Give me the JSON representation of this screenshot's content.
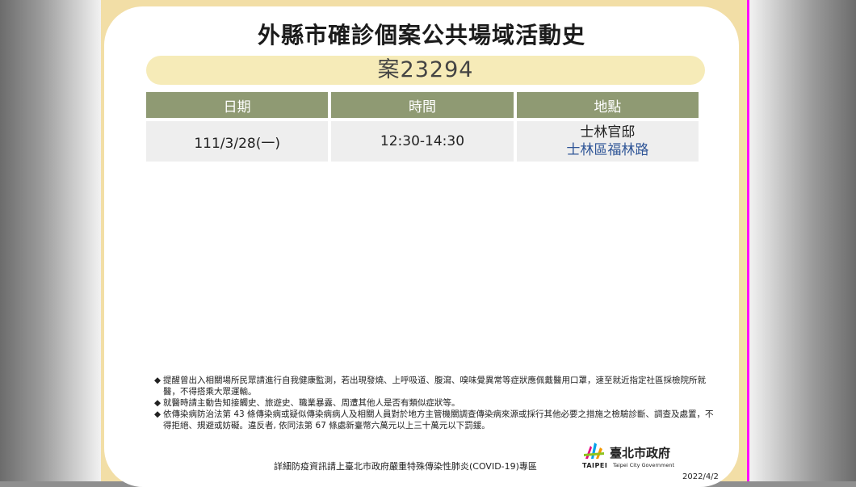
{
  "title": "外縣市確診個案公共場域活動史",
  "case_label": "案23294",
  "table": {
    "headers": [
      "日期",
      "時間",
      "地點"
    ],
    "rows": [
      {
        "date": "111/3/28(一)",
        "time": "12:30-14:30",
        "location_name": "士林官邸",
        "location_address": "士林區福林路"
      }
    ]
  },
  "notes": {
    "bullet": "◆",
    "items": [
      "提醒曾出入相關場所民眾請進行自我健康監測，若出現發燒、上呼吸道、腹瀉、嗅味覺異常等症狀應佩戴醫用口罩，速至就近指定社區採檢院所就醫，不得搭乘大眾運輸。",
      "就醫時請主動告知接觸史、旅遊史、職業暴露、周遭其他人是否有類似症狀等。",
      "依傳染病防治法第 43 條傳染病或疑似傳染病病人及相關人員對於地方主管機關調查傳染病來源或採行其他必要之措施之檢驗診斷、調查及處置，不得拒絕、規避或妨礙。違反者, 依同法第 67 條處新臺幣六萬元以上三十萬元以下罰鍰。"
    ]
  },
  "footer": {
    "info": "詳細防疫資訊請上臺北市政府嚴重特殊傳染性肺炎(COVID-19)專區",
    "logo_cn": "臺北市政府",
    "logo_taipei": "TAIPEI",
    "logo_en": "Taipei City Government",
    "date": "2022/4/2"
  },
  "colors": {
    "card_background": "#f2dea6",
    "case_pill": "#f6ebb8",
    "table_header": "#8f9a73",
    "table_cell": "#eeeeee",
    "address_text": "#2f5597"
  }
}
